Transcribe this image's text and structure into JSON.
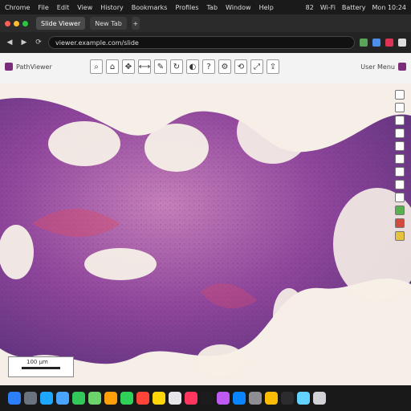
{
  "menubar": {
    "items": [
      "Chrome",
      "File",
      "Edit",
      "View",
      "History",
      "Bookmarks",
      "Profiles",
      "Tab",
      "Window",
      "Help"
    ],
    "right_items": [
      "82",
      "Wi‑Fi",
      "Battery",
      "Mon 10:24"
    ]
  },
  "tabs": {
    "items": [
      {
        "label": "Slide Viewer",
        "active": true
      },
      {
        "label": "New Tab",
        "active": false
      }
    ]
  },
  "toolbar": {
    "url": "viewer.example.com/slide",
    "back_icon": "back-arrow-icon",
    "forward_icon": "forward-arrow-icon",
    "reload_icon": "reload-icon"
  },
  "viewer": {
    "brand_left": "PathViewer",
    "brand_right": "User Menu",
    "tool_icons": [
      "zoom-icon",
      "home-icon",
      "pan-icon",
      "measure-icon",
      "annotate-icon",
      "rotate-icon",
      "overlay-icon",
      "help-icon",
      "settings-icon",
      "reset-icon",
      "fullscreen-icon",
      "share-icon"
    ],
    "right_tool_icons": [
      "zoom-in-icon",
      "zoom-out-icon",
      "fit-icon",
      "rotate-icon",
      "layer-icon",
      "grid-icon",
      "ruler-icon",
      "pen-icon",
      "eraser-icon",
      "flag-green-icon",
      "flag-red-icon",
      "flag-yellow-icon"
    ]
  },
  "scalebar": {
    "label": "100 µm"
  },
  "dock": {
    "icons": [
      "finder-icon",
      "launchpad-icon",
      "safari-icon",
      "mail-icon",
      "messages-icon",
      "maps-icon",
      "photos-icon",
      "facetime-icon",
      "calendar-icon",
      "notes-icon",
      "reminders-icon",
      "music-icon",
      "tv-icon",
      "podcasts-icon",
      "app-store-icon",
      "settings-icon",
      "chrome-icon",
      "terminal-icon",
      "preview-icon",
      "trash-icon"
    ]
  },
  "colors": {
    "tissue_pink": "#c47ab8",
    "tissue_purple": "#5a2a7a",
    "background": "#f6efe7",
    "stain_red": "#d94b6b"
  }
}
